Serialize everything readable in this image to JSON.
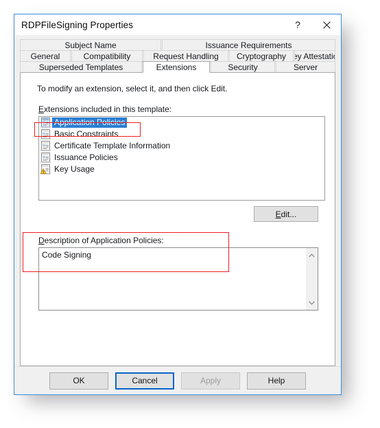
{
  "window": {
    "title": "RDPFileSigning Properties",
    "help_icon": "question-mark-icon",
    "close_icon": "close-icon",
    "help_label": "?",
    "accent_border": "#3a8ddd"
  },
  "tabs": {
    "row1": [
      {
        "label": "Subject Name",
        "active": false
      },
      {
        "label": "Issuance Requirements",
        "active": false
      }
    ],
    "row2": [
      {
        "label": "General",
        "active": false
      },
      {
        "label": "Compatibility",
        "active": false
      },
      {
        "label": "Request Handling",
        "active": false
      },
      {
        "label": "Cryptography",
        "active": false
      },
      {
        "label": "Key Attestation",
        "active": false
      }
    ],
    "row3": [
      {
        "label": "Superseded Templates",
        "active": false
      },
      {
        "label": "Extensions",
        "active": true
      },
      {
        "label": "Security",
        "active": false
      },
      {
        "label": "Server",
        "active": false
      }
    ],
    "selected": "Extensions"
  },
  "page": {
    "hint": "To modify an extension, select it, and then click Edit.",
    "list_label_accel": "E",
    "list_label_rest": "xtensions included in this template:",
    "extensions": [
      {
        "label": "Application Policies",
        "icon": "certificate-extension-icon",
        "selected": true,
        "warning": false
      },
      {
        "label": "Basic Constraints",
        "icon": "certificate-extension-icon",
        "selected": false,
        "warning": false
      },
      {
        "label": "Certificate Template Information",
        "icon": "certificate-extension-icon",
        "selected": false,
        "warning": false
      },
      {
        "label": "Issuance Policies",
        "icon": "certificate-extension-icon",
        "selected": false,
        "warning": false
      },
      {
        "label": "Key Usage",
        "icon": "certificate-extension-warning-icon",
        "selected": false,
        "warning": true
      }
    ],
    "edit_button": {
      "accel": "E",
      "rest": "dit...",
      "enabled": true
    },
    "description_label_accel": "D",
    "description_label_rest": "escription of Application Policies:",
    "description_value": "Code Signing",
    "scroll_up_icon": "chevron-up-icon",
    "scroll_down_icon": "chevron-down-icon"
  },
  "footer": {
    "ok": "OK",
    "cancel": "Cancel",
    "apply": "Apply",
    "help": "Help",
    "apply_enabled": false,
    "default_button": "Cancel"
  },
  "colors": {
    "selection_blue": "#2a7fd4",
    "annotation_red": "#ee1c22",
    "dialog_face": "#f0f0f0",
    "page_white": "#ffffff",
    "disabled_text": "#9d9d9d"
  }
}
